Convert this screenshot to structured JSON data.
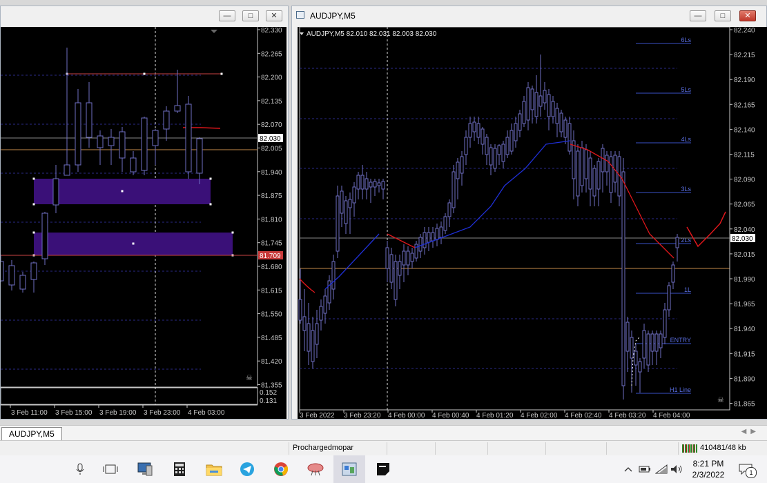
{
  "left_window": {
    "price_labels": [
      "82.330",
      "82.265",
      "82.200",
      "82.135",
      "82.070",
      "82.005",
      "81.940",
      "81.875",
      "81.810",
      "81.745",
      "81.680",
      "81.615",
      "81.550",
      "81.485",
      "81.420",
      "81.355"
    ],
    "current_price": "82.030",
    "marker_price": "81.709",
    "indicator_labels": [
      "0.152",
      "0.131"
    ],
    "time_labels": [
      "3 Feb 11:00",
      "3 Feb 15:00",
      "3 Feb 19:00",
      "3 Feb 23:00",
      "4 Feb 03:00"
    ]
  },
  "right_window": {
    "title": "AUDJPY,M5",
    "info_text": "AUDJPY,M5  82.010 82.031 82.003 82.030",
    "price_labels": [
      "82.240",
      "82.215",
      "82.190",
      "82.165",
      "82.140",
      "82.115",
      "82.090",
      "82.065",
      "82.040",
      "82.015",
      "81.990",
      "81.965",
      "81.940",
      "81.915",
      "81.890",
      "81.865"
    ],
    "current_price": "82.030",
    "level_labels": [
      "6Ls",
      "5Ls",
      "4Ls",
      "3Ls",
      "2Ls",
      "1L",
      "ENTRY",
      "H1 Line"
    ],
    "time_labels": [
      "3 Feb 2022",
      "3 Feb 23:20",
      "4 Feb 00:00",
      "4 Feb 00:40",
      "4 Feb 01:20",
      "4 Feb 02:00",
      "4 Feb 02:40",
      "4 Feb 03:20",
      "4 Feb 04:00"
    ]
  },
  "tab": {
    "label": "AUDJPY,M5"
  },
  "status": {
    "profile": "Prochargedmopar",
    "traffic": "410481/48 kb"
  },
  "clock": {
    "time": "8:21 PM",
    "date": "2/3/2022"
  },
  "notification_count": "1",
  "colors": {
    "chart_bg": "#000000",
    "candle": "#6f6fc4",
    "zone": "#3a1078",
    "ma_blue": "#1f2fd6",
    "ma_red": "#e0161b",
    "level_line": "#3a52c8",
    "entry_line": "#c48a4a"
  },
  "icons": [
    "microphone-icon",
    "task-view-icon",
    "computer-icon",
    "calculator-icon",
    "file-explorer-icon",
    "telegram-icon",
    "chrome-icon",
    "app-icon",
    "metatrader-icon",
    "sticky-notes-icon",
    "chevron-up-icon",
    "battery-icon",
    "wifi-icon",
    "volume-icon",
    "notification-icon"
  ]
}
